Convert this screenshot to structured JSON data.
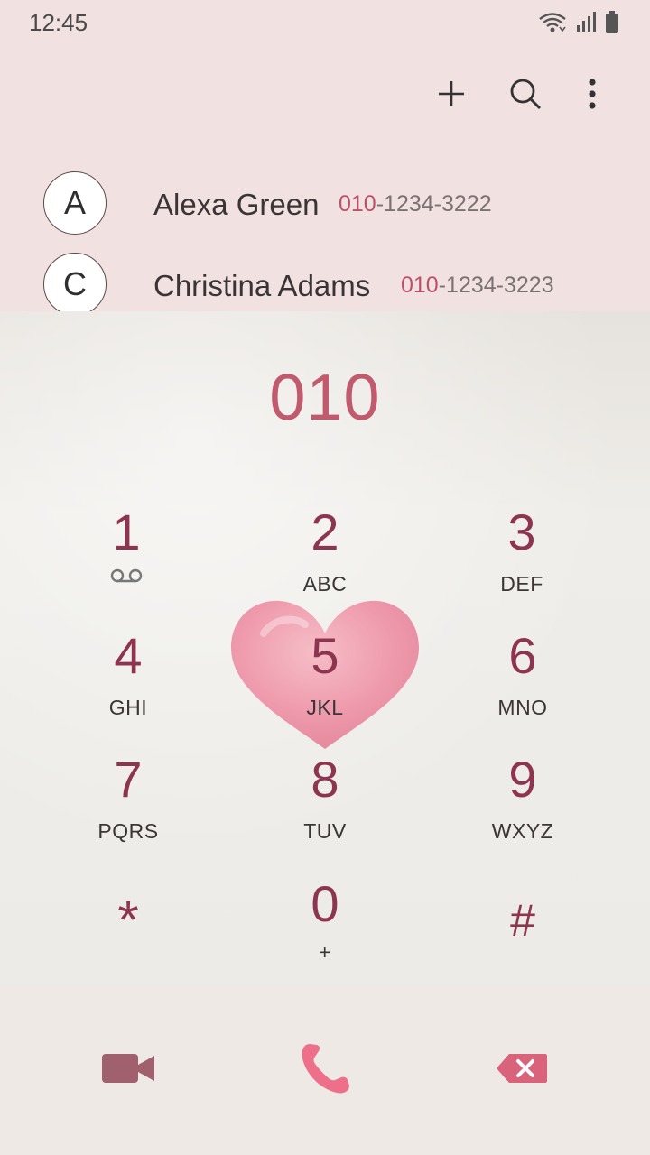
{
  "status": {
    "time": "12:45",
    "icons": [
      "wifi-icon",
      "signal-icon",
      "battery-icon"
    ]
  },
  "toolbar": {
    "icons": [
      "add-icon",
      "search-icon",
      "more-options-icon"
    ]
  },
  "suggestions": [
    {
      "initial": "A",
      "name": "Alexa Green",
      "number_prefix": "010",
      "number_rest": "-1234-3222"
    },
    {
      "initial": "C",
      "name": "Christina Adams",
      "number_prefix": "010",
      "number_rest": "-1234-3223"
    }
  ],
  "dialer": {
    "typed": "010",
    "keys": [
      {
        "digit": "1",
        "letters": "",
        "icon": "voicemail-icon"
      },
      {
        "digit": "2",
        "letters": "ABC"
      },
      {
        "digit": "3",
        "letters": "DEF"
      },
      {
        "digit": "4",
        "letters": "GHI"
      },
      {
        "digit": "5",
        "letters": "JKL"
      },
      {
        "digit": "6",
        "letters": "MNO"
      },
      {
        "digit": "7",
        "letters": "PQRS"
      },
      {
        "digit": "8",
        "letters": "TUV"
      },
      {
        "digit": "9",
        "letters": "WXYZ"
      },
      {
        "digit": "*",
        "letters": ""
      },
      {
        "digit": "0",
        "letters": "+"
      },
      {
        "digit": "#",
        "letters": ""
      }
    ]
  },
  "bottom": {
    "icons": [
      "video-call-icon",
      "call-icon",
      "backspace-icon"
    ]
  },
  "colors": {
    "accent": "#c0506a",
    "digit": "#8d3550",
    "top_background": "#f2e1e1"
  }
}
